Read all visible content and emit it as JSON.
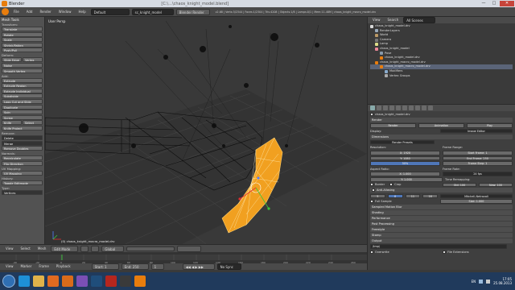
{
  "window": {
    "title": "Blender",
    "file_title": "[C:\\...\\chaos_knight_model.blend]",
    "min": "—",
    "max": "□",
    "close": "✕"
  },
  "info_header": {
    "menus": [
      "File",
      "Add",
      "Render",
      "Window",
      "Help"
    ],
    "screen": "Default",
    "scene": "sc_knight_model",
    "engine": "Blender Render",
    "stats": "v2.68 | Verts:3/2344 | Faces:1/2304 | Tris:4208 | Objects:1/8 | Lamps:0/1 | Mem:11.48M | chaos_knight_macro_model.drv"
  },
  "tool_shelf": {
    "title": "Mesh Tools",
    "sections": {
      "transform": "Transform:",
      "deform": "Deform:",
      "add": "Add:",
      "remove": "Remove:",
      "normals": "Normals:",
      "shading": "Shading:",
      "uv_mapping": "UV Mapping:",
      "history": "History:"
    },
    "transform_buttons": [
      "Translate",
      "Rotate",
      "Scale",
      "Shrink/Fatten",
      "Push/Pull"
    ],
    "deform_buttons": {
      "slide_edge": "Slide Edge",
      "vertex": "Vertex",
      "noise": "Noise",
      "smooth_vertex": "Smooth Vertex"
    },
    "add_buttons": [
      "Extrude",
      "Extrude Region",
      "Extrude Individual",
      "Subdivide",
      "Loop Cut and Slide",
      "Duplicate",
      "Spin",
      "Screw"
    ],
    "knife": "Knife",
    "select": "Select",
    "knife_project": "Knife Project",
    "remove_buttons": [
      "Delete",
      "Merge",
      "Remove Doubles"
    ],
    "normals_buttons": [
      "Recalculate",
      "Flip Direction"
    ],
    "uv_button": "UV Mapping",
    "toggle_editmode": "Toggle Editmode",
    "type_label": "Type:",
    "type_value": "Vertices"
  },
  "viewport": {
    "view_label": "User Persp",
    "object_label": "(0) chaos_knight_macro_model.drv"
  },
  "viewport_header": {
    "view": "View",
    "select": "Select",
    "mesh": "Mesh",
    "mode": "Edit Mode",
    "pivot": "Global"
  },
  "timeline": {
    "numbers": [
      "-40",
      "-20",
      "0",
      "20",
      "40",
      "60",
      "80",
      "100",
      "120",
      "140",
      "160",
      "180",
      "200",
      "220",
      "240",
      "260"
    ],
    "menus": [
      "View",
      "Marker",
      "Frame",
      "Playback"
    ],
    "start": "Start: 1",
    "end": "End: 250",
    "current": "1",
    "sync": "No Sync"
  },
  "outliner": {
    "view": "View",
    "search": "Search",
    "scenes": "All Scenes",
    "items": [
      {
        "label": "chaos_knight_model.drv",
        "color": "#d9d9d9",
        "indent": 0
      },
      {
        "label": "RenderLayers",
        "color": "#9ab",
        "indent": 1
      },
      {
        "label": "World",
        "color": "#b96",
        "indent": 1
      },
      {
        "label": "Camera",
        "color": "#777",
        "indent": 1
      },
      {
        "label": "Lamp",
        "color": "#dd8",
        "indent": 1
      },
      {
        "label": "chaos_knight_model",
        "color": "#e89",
        "indent": 1
      },
      {
        "label": "Pose",
        "color": "#89a",
        "indent": 2
      },
      {
        "label": "chaos_knight_model.drv",
        "color": "#e87d0d",
        "indent": 2
      },
      {
        "label": "chaos_knight_macro_model.drv",
        "color": "#e87d0d",
        "indent": 1
      },
      {
        "label": "chaos_knight_macro_model.drv",
        "color": "#e87d0d",
        "indent": 2
      },
      {
        "label": "Modifiers",
        "color": "#8ac",
        "indent": 3
      },
      {
        "label": "Vertex Groups",
        "color": "#aaa",
        "indent": 3
      }
    ]
  },
  "properties": {
    "object": "chaos_knight_model.drv",
    "render": {
      "title": "Render",
      "render_btn": "Render",
      "animation_btn": "Animation",
      "play_btn": "Play",
      "display_label": "Display:",
      "display_value": "Image Editor"
    },
    "dimensions": {
      "title": "Dimensions",
      "presets": "Render Presets",
      "resolution_label": "Resolution:",
      "res_x": "X: 1920",
      "res_y": "Y: 1080",
      "res_pct": "50%",
      "frame_range_label": "Frame Range:",
      "start": "Start Frame: 1",
      "end": "End Frame: 250",
      "step": "Frame Step: 1",
      "aspect_label": "Aspect Ratio:",
      "aspect_x": "X: 1.000",
      "aspect_y": "Y: 1.000",
      "frame_rate_label": "Frame Rate:",
      "fps": "24 fps",
      "time_remap": "Time Remapping:",
      "old": "Old: 100",
      "new": "New: 100",
      "border": "Border",
      "crop": "Crop"
    },
    "anti_aliasing": {
      "title": "Anti-Aliasing",
      "samples": [
        "5",
        "8",
        "11",
        "16"
      ],
      "filter": "Mitchell-Netravali",
      "full_sample": "Full Sample",
      "size": "Size: 1.000"
    },
    "collapsed": [
      "Sampled Motion Blur",
      "Shading",
      "Performance",
      "Post Processing",
      "Freestyle",
      "Stamp",
      "Output"
    ],
    "output_path": "/tmp\\",
    "overwrite": "Overwrite",
    "file_ext": "File Extensions"
  },
  "taskbar": {
    "time": "17:05",
    "date": "25.08.2013",
    "lang": "EN",
    "apps": [
      {
        "name": "ie",
        "color": "#1e90d6"
      },
      {
        "name": "explorer",
        "color": "#e0b34a"
      },
      {
        "name": "media",
        "color": "#e06a20"
      },
      {
        "name": "firefox",
        "color": "#d96b1a"
      },
      {
        "name": "visual-studio",
        "color": "#7b4fb5"
      },
      {
        "name": "photoshop",
        "color": "#1f4d7a"
      },
      {
        "name": "dota",
        "color": "#b5261e"
      },
      {
        "name": "steam",
        "color": "#3a3a3a"
      },
      {
        "name": "blender",
        "color": "#e87d0d"
      }
    ]
  }
}
